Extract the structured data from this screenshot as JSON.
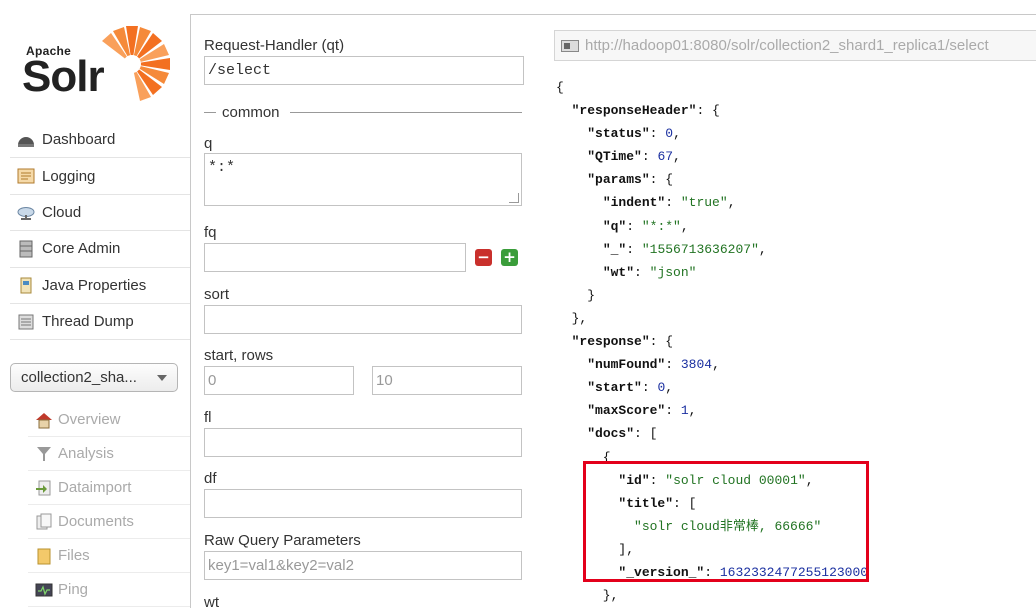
{
  "logo": {
    "apache": "Apache",
    "solr": "Solr"
  },
  "sidebar": {
    "items": [
      {
        "label": "Dashboard",
        "icon": "dashboard-icon"
      },
      {
        "label": "Logging",
        "icon": "logging-icon"
      },
      {
        "label": "Cloud",
        "icon": "cloud-icon"
      },
      {
        "label": "Core Admin",
        "icon": "core-admin-icon"
      },
      {
        "label": "Java Properties",
        "icon": "java-properties-icon"
      },
      {
        "label": "Thread Dump",
        "icon": "thread-dump-icon"
      }
    ],
    "core_selector": "collection2_sha...",
    "core_items": [
      {
        "label": "Overview",
        "icon": "home-icon"
      },
      {
        "label": "Analysis",
        "icon": "funnel-icon"
      },
      {
        "label": "Dataimport",
        "icon": "dataimport-icon"
      },
      {
        "label": "Documents",
        "icon": "documents-icon"
      },
      {
        "label": "Files",
        "icon": "folder-icon"
      },
      {
        "label": "Ping",
        "icon": "ping-icon"
      }
    ]
  },
  "form": {
    "handler_label": "Request-Handler (qt)",
    "handler_value": "/select",
    "section_label": "common",
    "q_label": "q",
    "q_value": "*:*",
    "fq_label": "fq",
    "fq_value": "",
    "sort_label": "sort",
    "sort_value": "",
    "start_rows_label": "start, rows",
    "start_placeholder": "0",
    "rows_placeholder": "10",
    "fl_label": "fl",
    "fl_value": "",
    "df_label": "df",
    "df_value": "",
    "raw_label": "Raw Query Parameters",
    "raw_placeholder": "key1=val1&key2=val2",
    "wt_label": "wt"
  },
  "response": {
    "url": "http://hadoop01:8080/solr/collection2_shard1_replica1/select",
    "responseHeader": {
      "status": "0",
      "QTime": "67",
      "params": {
        "indent": "true",
        "q": "*:*",
        "_": "1556713636207",
        "wt": "json"
      }
    },
    "response": {
      "numFound": "3804",
      "start": "0",
      "maxScore": "1",
      "doc": {
        "id": "solr cloud 00001",
        "title": "solr cloud非常棒, 66666",
        "_version_": "1632332477255123000"
      }
    }
  },
  "colors": {
    "highlight": "#e3001b",
    "string": "#217322",
    "number": "#1a2fa0"
  }
}
